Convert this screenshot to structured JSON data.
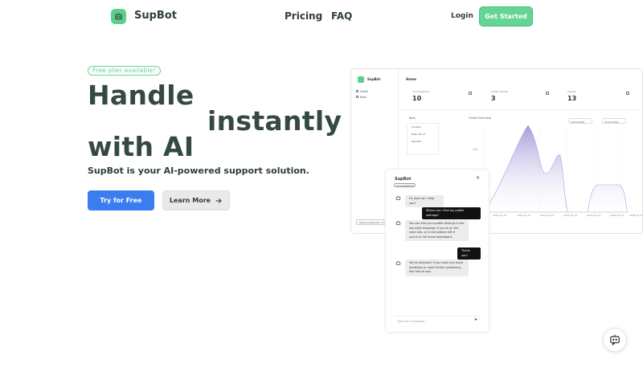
{
  "nav": {
    "brand": "SupBot",
    "links": [
      "Pricing",
      "FAQ"
    ],
    "login": "Login",
    "get_started": "Get Started"
  },
  "hero": {
    "badge": "Free plan available!",
    "headline": [
      "Handle",
      "instantly",
      "with AI"
    ],
    "subhead": "SupBot is your AI-powered support solution.",
    "primary_button": "Try for Free",
    "secondary_button": "Learn More"
  },
  "dashboard": {
    "brand": "SupBot",
    "nav": [
      "Home",
      "Bots"
    ],
    "title": "Home",
    "stats": [
      {
        "label": "Conversations",
        "value": "10"
      },
      {
        "label": "Active Tickets",
        "value": "3"
      },
      {
        "label": "Tickets",
        "value": "13"
      }
    ],
    "bots_title": "Bots",
    "bots": [
      "Coolbot",
      "Help bot v2",
      "Test Bot"
    ],
    "chart_title": "Ticket Overview",
    "date_from": "03/11/2024",
    "date_to": "07/11/2024",
    "x_labels": [
      "2024-07-10",
      "2024-07-11",
      "2024-07-12",
      "2024-07-13",
      "2024-07-14",
      "2024-07-15",
      "2024-07-16"
    ],
    "y_label": "0.5",
    "email": "olepersen@gmail.com"
  },
  "chat": {
    "title": "SupBot",
    "subtitle": "Conversations",
    "messages": [
      {
        "from": "bot",
        "text": "Hi, how can I help you?"
      },
      {
        "from": "user",
        "text": "Where can I find my profile settings?"
      },
      {
        "from": "bot",
        "text": "You can find your profile settings in the top-right dropdown if you're on the main site, or in the bottom left if you're in the home dashboard."
      },
      {
        "from": "user",
        "text": "Thank you!"
      },
      {
        "from": "bot",
        "text": "You're welcome! If you have any more questions or need further assistance, feel free to ask!"
      }
    ],
    "input_placeholder": "Type your message..."
  },
  "colors": {
    "accent_green": "#66d495",
    "primary_blue": "#3b7df0",
    "heading": "#344a40",
    "chart_fill": "#9b93d6"
  }
}
